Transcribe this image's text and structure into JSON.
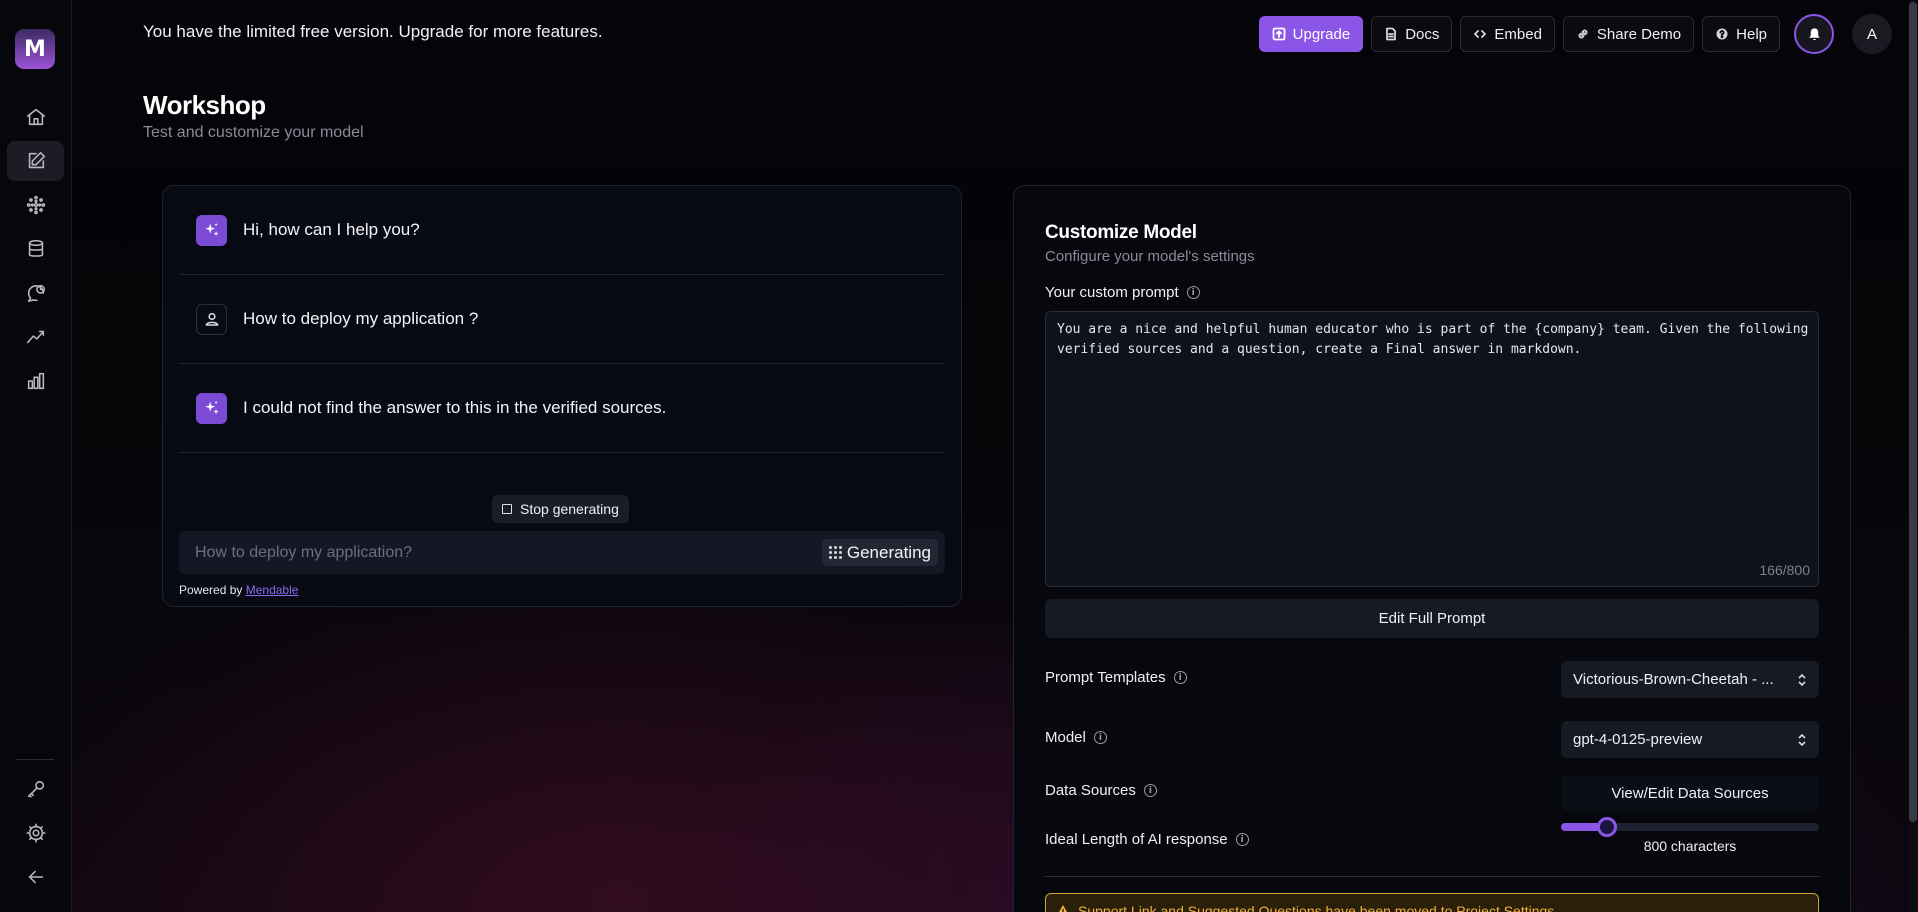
{
  "banner": {
    "message": "You have the limited free version. Upgrade for more features."
  },
  "topbar": {
    "upgrade_label": "Upgrade",
    "docs_label": "Docs",
    "embed_label": "Embed",
    "share_demo_label": "Share Demo",
    "help_label": "Help",
    "avatar_initial": "A"
  },
  "sidebar": {
    "logo_letter": "M",
    "items": [
      {
        "icon": "home-icon"
      },
      {
        "icon": "pencil-square-icon",
        "active": true
      },
      {
        "icon": "sparkle-dots-icon"
      },
      {
        "icon": "database-icon"
      },
      {
        "icon": "chat-clock-icon"
      },
      {
        "icon": "trend-line-icon"
      },
      {
        "icon": "bar-chart-icon"
      }
    ],
    "bottom_items": [
      {
        "icon": "key-icon"
      },
      {
        "icon": "gear-icon"
      },
      {
        "icon": "arrow-left-icon"
      }
    ]
  },
  "page": {
    "title": "Workshop",
    "subtitle": "Test and customize your model"
  },
  "chat": {
    "messages": [
      {
        "role": "assistant",
        "text": "Hi, how can I help you?"
      },
      {
        "role": "user",
        "text": "How to deploy my application ?"
      },
      {
        "role": "assistant",
        "text": "I could not find the answer to this in the verified sources."
      }
    ],
    "stop_label": "Stop generating",
    "input_placeholder": "How to deploy my application?",
    "generating_label": "Generating",
    "powered_by": "Powered by",
    "powered_by_link": "Mendable"
  },
  "customize": {
    "title": "Customize Model",
    "subtitle": "Configure your model's settings",
    "prompt_label": "Your custom prompt",
    "prompt_value": "You are a nice and helpful human educator who is part of the {company} team. Given the following verified sources and a question, create a Final answer in markdown.",
    "prompt_count": "166/800",
    "edit_full_prompt_label": "Edit Full Prompt",
    "prompt_templates_label": "Prompt Templates",
    "prompt_template_value": "Victorious-Brown-Cheetah - ...",
    "model_label": "Model",
    "model_value": "gpt-4-0125-preview",
    "data_sources_label": "Data Sources",
    "data_sources_button": "View/Edit Data Sources",
    "ideal_length_label": "Ideal Length of AI response",
    "ideal_length_value": "800 characters",
    "ideal_length_fraction": 0.18,
    "warning_text": "Support Link and Suggested Questions have been moved to Project Settings"
  },
  "colors": {
    "accent": "#8b55e8",
    "warning": "#f3b23f"
  }
}
